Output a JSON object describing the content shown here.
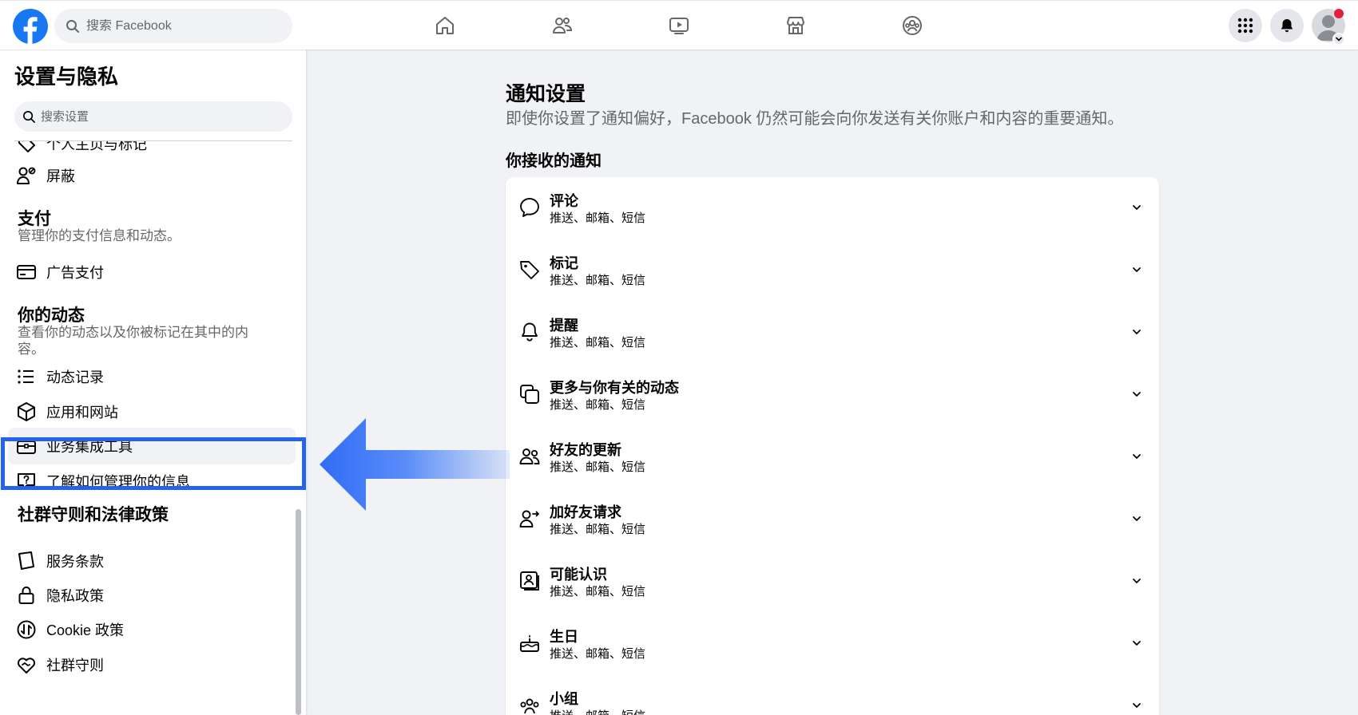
{
  "topbar": {
    "search_placeholder": "搜索 Facebook",
    "nav_icons": [
      "home-icon",
      "friends-icon",
      "watch-icon",
      "marketplace-icon",
      "groups-icon"
    ],
    "menu_icon": "grid-menu-icon",
    "notifications_icon": "bell-icon",
    "avatar_icon": "avatar-icon"
  },
  "sidebar": {
    "title": "设置与隐私",
    "search_placeholder": "搜索设置",
    "items_top": [
      {
        "label": "个人主页与标记",
        "icon": "tag-icon"
      },
      {
        "label": "屏蔽",
        "icon": "block-person-icon"
      }
    ],
    "payments": {
      "heading": "支付",
      "description": "管理你的支付信息和动态。",
      "items": [
        {
          "label": "广告支付",
          "icon": "card-icon"
        }
      ]
    },
    "activity": {
      "heading": "你的动态",
      "description": "查看你的动态以及你被标记在其中的内容。",
      "items": [
        {
          "label": "动态记录",
          "icon": "list-icon"
        },
        {
          "label": "应用和网站",
          "icon": "cube-icon"
        },
        {
          "label": "业务集成工具",
          "icon": "briefcase-icon",
          "active": true
        },
        {
          "label": "了解如何管理你的信息",
          "icon": "question-bubble-icon"
        }
      ]
    },
    "legal": {
      "heading": "社群守则和法律政策",
      "items": [
        {
          "label": "服务条款",
          "icon": "book-icon"
        },
        {
          "label": "隐私政策",
          "icon": "lock-icon"
        },
        {
          "label": "Cookie 政策",
          "icon": "cookie-icon"
        },
        {
          "label": "社群守则",
          "icon": "handshake-heart-icon"
        }
      ]
    }
  },
  "main": {
    "title": "通知设置",
    "description": "即使你设置了通知偏好，Facebook 仍然可能会向你发送有关你账户和内容的重要通知。",
    "section_title": "你接收的通知",
    "notifications": [
      {
        "name": "评论",
        "channels": "推送、邮箱、短信",
        "icon": "comment-icon"
      },
      {
        "name": "标记",
        "channels": "推送、邮箱、短信",
        "icon": "tag-icon"
      },
      {
        "name": "提醒",
        "channels": "推送、邮箱、短信",
        "icon": "bell-icon"
      },
      {
        "name": "更多与你有关的动态",
        "channels": "推送、邮箱、短信",
        "icon": "copy-icon"
      },
      {
        "name": "好友的更新",
        "channels": "推送、邮箱、短信",
        "icon": "friends-icon"
      },
      {
        "name": "加好友请求",
        "channels": "推送、邮箱、短信",
        "icon": "friend-request-icon"
      },
      {
        "name": "可能认识",
        "channels": "推送、邮箱、短信",
        "icon": "contact-card-icon"
      },
      {
        "name": "生日",
        "channels": "推送、邮箱、短信",
        "icon": "cake-icon"
      },
      {
        "name": "小组",
        "channels": "推送、邮箱、短信",
        "icon": "group-icon"
      }
    ]
  },
  "colors": {
    "brand": "#1877f2",
    "highlight": "#2563eb",
    "notification_dot": "#e41e3f",
    "secondary_text": "#65676b",
    "background": "#f0f2f5"
  }
}
